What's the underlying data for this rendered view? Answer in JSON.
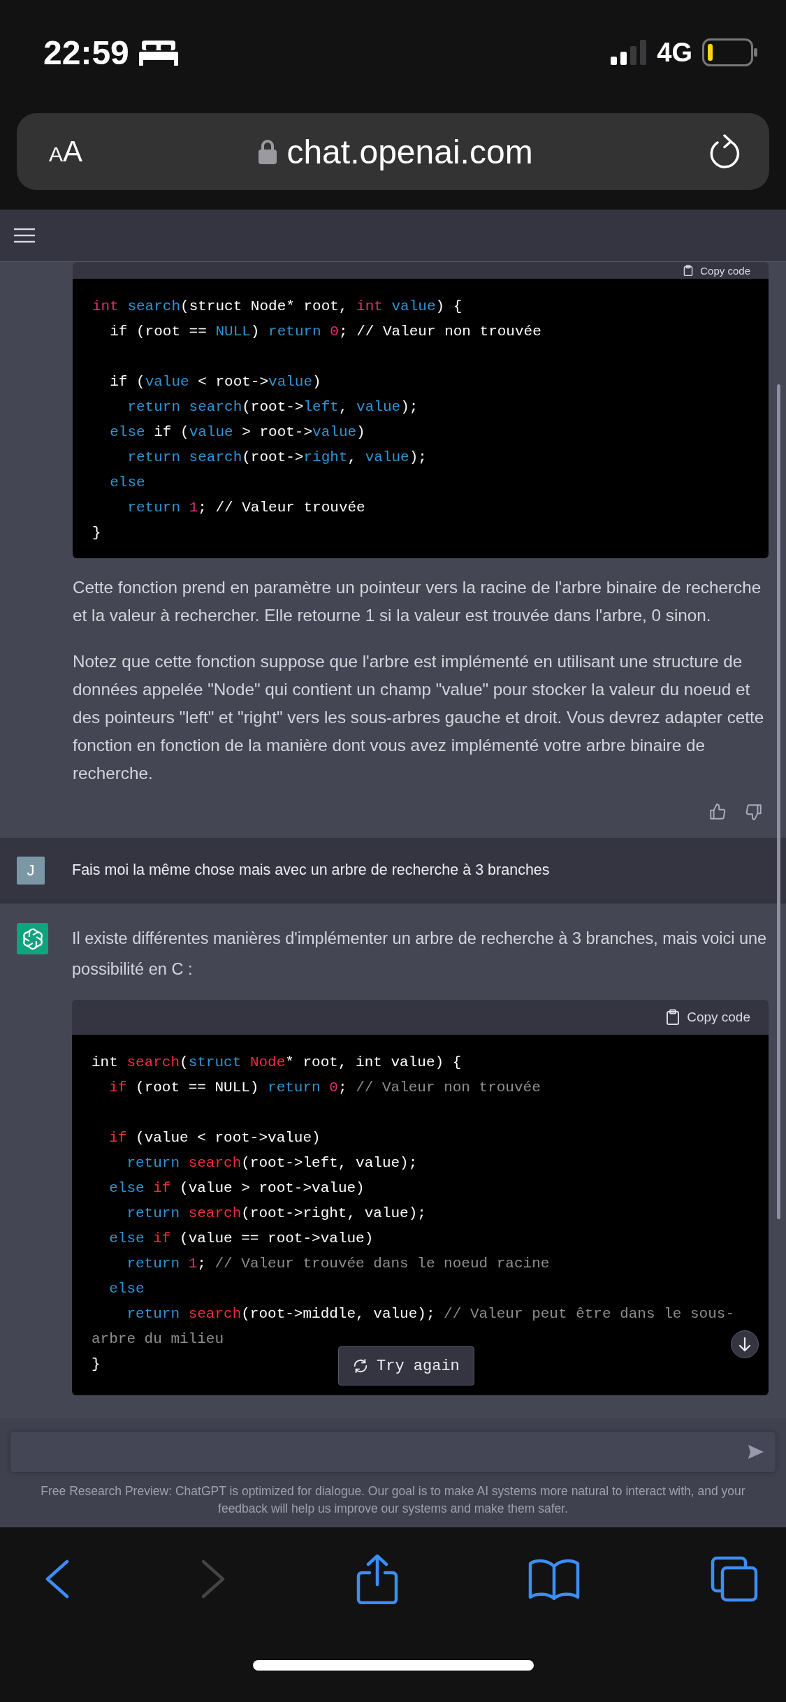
{
  "status_bar": {
    "time": "22:59",
    "network": "4G"
  },
  "browser_bar": {
    "text_size_button": "AA",
    "url": "chat.openai.com"
  },
  "thread": [
    {
      "kind": "code_tail",
      "copy_label": "Copy code",
      "lines": [
        {
          "kind": "code",
          "tokens": [
            {
              "text": "int",
              "color": "#df3079"
            },
            {
              "text": " search",
              "color": "#2e95d3"
            },
            {
              "text": "(struct Node* root, ",
              "color": "#ffffff"
            },
            {
              "text": "int",
              "color": "#df3079"
            },
            {
              "text": " value",
              "color": "#2e95d3"
            },
            {
              "text": ") {",
              "color": "#ffffff"
            }
          ]
        },
        {
          "kind": "code",
          "tokens": [
            {
              "text": "  if (root == ",
              "color": "#ffffff"
            },
            {
              "text": "NULL",
              "color": "#2e95d3"
            },
            {
              "text": ") ",
              "color": "#ffffff"
            },
            {
              "text": "return",
              "color": "#2e95d3"
            },
            {
              "text": " 0",
              "color": "#df3079"
            },
            {
              "text": "; // Valeur non trouvée",
              "color": "#ffffff"
            }
          ]
        },
        {
          "kind": "blank"
        },
        {
          "kind": "code",
          "tokens": [
            {
              "text": "  if (",
              "color": "#ffffff"
            },
            {
              "text": "value",
              "color": "#2e95d3"
            },
            {
              "text": " < root->",
              "color": "#ffffff"
            },
            {
              "text": "value",
              "color": "#2e95d3"
            },
            {
              "text": ")",
              "color": "#ffffff"
            }
          ]
        },
        {
          "kind": "code",
          "tokens": [
            {
              "text": "    return search",
              "color": "#2e95d3"
            },
            {
              "text": "(root->",
              "color": "#ffffff"
            },
            {
              "text": "left",
              "color": "#2e95d3"
            },
            {
              "text": ", ",
              "color": "#ffffff"
            },
            {
              "text": "value",
              "color": "#2e95d3"
            },
            {
              "text": ");",
              "color": "#ffffff"
            }
          ]
        },
        {
          "kind": "code",
          "tokens": [
            {
              "text": "  else",
              "color": "#2e95d3"
            },
            {
              "text": " if (",
              "color": "#ffffff"
            },
            {
              "text": "value",
              "color": "#2e95d3"
            },
            {
              "text": " > root->",
              "color": "#ffffff"
            },
            {
              "text": "value",
              "color": "#2e95d3"
            },
            {
              "text": ")",
              "color": "#ffffff"
            }
          ]
        },
        {
          "kind": "code",
          "tokens": [
            {
              "text": "    return search",
              "color": "#2e95d3"
            },
            {
              "text": "(root->",
              "color": "#ffffff"
            },
            {
              "text": "right",
              "color": "#2e95d3"
            },
            {
              "text": ", ",
              "color": "#ffffff"
            },
            {
              "text": "value",
              "color": "#2e95d3"
            },
            {
              "text": ");",
              "color": "#ffffff"
            }
          ]
        },
        {
          "kind": "code",
          "tokens": [
            {
              "text": "  else",
              "color": "#2e95d3"
            }
          ]
        },
        {
          "kind": "code",
          "tokens": [
            {
              "text": "    return",
              "color": "#2e95d3"
            },
            {
              "text": " 1",
              "color": "#df3079"
            },
            {
              "text": "; // Valeur trouvée",
              "color": "#ffffff"
            }
          ]
        },
        {
          "kind": "code",
          "tokens": [
            {
              "text": "}",
              "color": "#ffffff"
            }
          ]
        }
      ]
    },
    {
      "kind": "paragraph",
      "text": "Cette fonction prend en paramètre un pointeur vers la racine de l'arbre binaire de recherche et la valeur à rechercher. Elle retourne 1 si la valeur est trouvée dans l'arbre, 0 sinon."
    },
    {
      "kind": "paragraph",
      "text": "Notez que cette fonction suppose que l'arbre est implémenté en utilisant une structure de données appelée \"Node\" qui contient un champ \"value\" pour stocker la valeur du noeud et des pointeurs \"left\" et \"right\" vers les sous-arbres gauche et droit. Vous devrez adapter cette fonction en fonction de la manière dont vous avez implémenté votre arbre binaire de recherche."
    },
    {
      "kind": "feedback"
    }
  ],
  "user_message": {
    "avatar": "J",
    "text": "Fais moi la même chose mais avec un arbre de recherche à 3 branches"
  },
  "reply": {
    "text": "Il existe différentes manières d'implémenter un arbre de recherche à 3 branches, mais voici une possibilité en C :",
    "code": {
      "copy_label": "Copy code",
      "lines": [
        {
          "kind": "code",
          "tokens": [
            {
              "text": "int ",
              "color": "#ffffff"
            },
            {
              "text": "search",
              "color": "#f22c3d"
            },
            {
              "text": "(",
              "color": "#ffffff"
            },
            {
              "text": "struct",
              "color": "#2e95d3"
            },
            {
              "text": " Node",
              "color": "#f22c3d"
            },
            {
              "text": "* root, int value) {",
              "color": "#ffffff"
            }
          ]
        },
        {
          "kind": "code",
          "tokens": [
            {
              "text": "  if",
              "color": "#f22c3d"
            },
            {
              "text": " (root == NULL) ",
              "color": "#ffffff"
            },
            {
              "text": "return",
              "color": "#2e95d3"
            },
            {
              "text": " 0",
              "color": "#df3079"
            },
            {
              "text": "; ",
              "color": "#ffffff"
            },
            {
              "text": "// Valeur non trouvée",
              "color": "#8e8e8e"
            }
          ]
        },
        {
          "kind": "blank"
        },
        {
          "kind": "code",
          "tokens": [
            {
              "text": "  if",
              "color": "#f22c3d"
            },
            {
              "text": " (value < root->value)",
              "color": "#ffffff"
            }
          ]
        },
        {
          "kind": "code",
          "tokens": [
            {
              "text": "    return",
              "color": "#2e95d3"
            },
            {
              "text": " search",
              "color": "#f22c3d"
            },
            {
              "text": "(root->left, value);",
              "color": "#ffffff"
            }
          ]
        },
        {
          "kind": "code",
          "tokens": [
            {
              "text": "  else",
              "color": "#2e95d3"
            },
            {
              "text": " if",
              "color": "#f22c3d"
            },
            {
              "text": " (value > root->value)",
              "color": "#ffffff"
            }
          ]
        },
        {
          "kind": "code",
          "tokens": [
            {
              "text": "    return",
              "color": "#2e95d3"
            },
            {
              "text": " search",
              "color": "#f22c3d"
            },
            {
              "text": "(root->right, value);",
              "color": "#ffffff"
            }
          ]
        },
        {
          "kind": "code",
          "tokens": [
            {
              "text": "  else",
              "color": "#2e95d3"
            },
            {
              "text": " if",
              "color": "#f22c3d"
            },
            {
              "text": " (value == root->value)",
              "color": "#ffffff"
            }
          ]
        },
        {
          "kind": "code",
          "tokens": [
            {
              "text": "    return",
              "color": "#2e95d3"
            },
            {
              "text": " 1",
              "color": "#df3079"
            },
            {
              "text": "; ",
              "color": "#ffffff"
            },
            {
              "text": "// Valeur trouvée dans le noeud racine",
              "color": "#8e8e8e"
            }
          ]
        },
        {
          "kind": "code",
          "tokens": [
            {
              "text": "  else",
              "color": "#2e95d3"
            }
          ]
        },
        {
          "kind": "code",
          "tokens": [
            {
              "text": "    return",
              "color": "#2e95d3"
            },
            {
              "text": " search",
              "color": "#f22c3d"
            },
            {
              "text": "(root->middle, value); ",
              "color": "#ffffff"
            },
            {
              "text": "// Valeur peut être dans le sous-",
              "color": "#8e8e8e"
            }
          ]
        },
        {
          "kind": "code",
          "tokens": [
            {
              "text": "arbre du milieu",
              "color": "#8e8e8e"
            }
          ]
        },
        {
          "kind": "code",
          "tokens": [
            {
              "text": "}",
              "color": "#ffffff"
            }
          ]
        }
      ]
    },
    "try_again": "Try again"
  },
  "footer_note": "Free Research Preview: ChatGPT is optimized for dialogue. Our goal is to make AI systems more natural to interact with, and your feedback will help us improve our systems and make them safer."
}
